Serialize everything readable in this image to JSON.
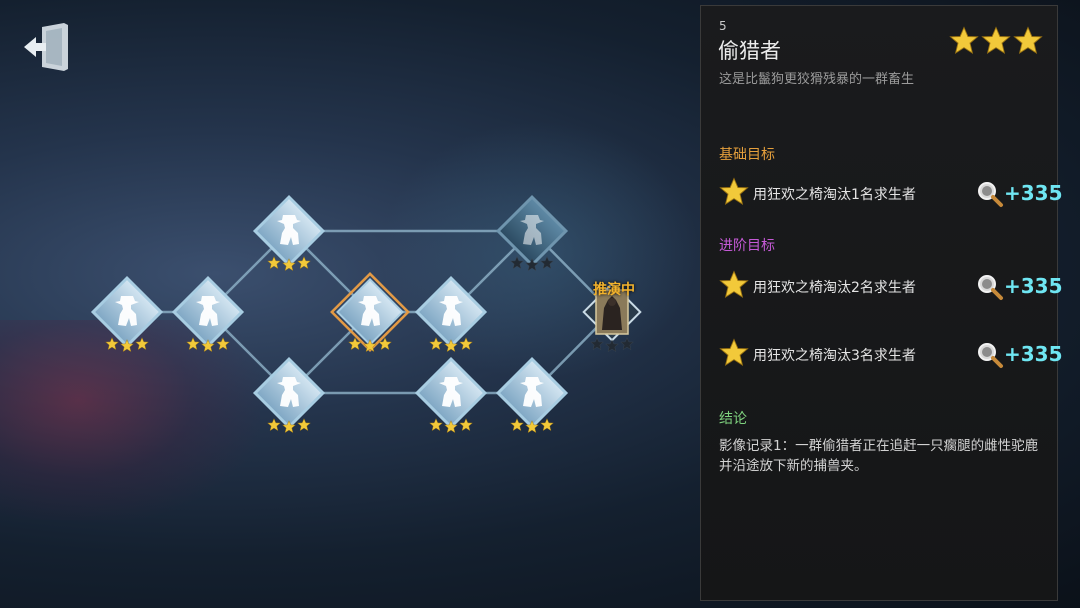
{
  "colors": {
    "node_fill": "#b7d3e6",
    "node_border": "#6fa8cc",
    "selected_border": "#e39a45",
    "star_gold": "#f2c93a",
    "basic_goal_label": "#e6a03c",
    "advanced_goal_label": "#c55ad6",
    "conclusion_label": "#7ed27e",
    "reward_color": "#6fe6f2"
  },
  "tree": {
    "in_progress_label": "推演中",
    "nodes": [
      {
        "id": "n1",
        "stars": 3,
        "state": "cleared"
      },
      {
        "id": "n2",
        "stars": 3,
        "state": "cleared"
      },
      {
        "id": "n3",
        "stars": 3,
        "state": "cleared"
      },
      {
        "id": "n4",
        "stars": 3,
        "state": "cleared"
      },
      {
        "id": "n5",
        "stars": 3,
        "state": "selected"
      },
      {
        "id": "n6",
        "stars": 3,
        "state": "cleared"
      },
      {
        "id": "n7",
        "stars": 3,
        "state": "cleared"
      },
      {
        "id": "n8",
        "stars": 0,
        "state": "locked"
      },
      {
        "id": "n9",
        "stars": 3,
        "state": "cleared"
      },
      {
        "id": "n10",
        "stars": 0,
        "state": "in-progress"
      }
    ]
  },
  "panel": {
    "chapter_number": "5",
    "title": "偷猎者",
    "rating_stars": 3,
    "subtitle": "这是比鬣狗更狡猾残暴的一群畜生",
    "basic_goal_label": "基础目标",
    "advanced_goal_label": "进阶目标",
    "goals": [
      {
        "text": "用狂欢之椅淘汰1名求生者",
        "reward": "+335",
        "icon": "magnifier-icon"
      },
      {
        "text": "用狂欢之椅淘汰2名求生者",
        "reward": "+335",
        "icon": "magnifier-icon"
      },
      {
        "text": "用狂欢之椅淘汰3名求生者",
        "reward": "+335",
        "icon": "magnifier-icon"
      }
    ],
    "conclusion_label": "结论",
    "conclusion_text": "影像记录1：一群偷猎者正在追赶一只瘸腿的雌性驼鹿并沿途放下新的捕兽夹。"
  },
  "exit_icon": "exit-door-icon"
}
